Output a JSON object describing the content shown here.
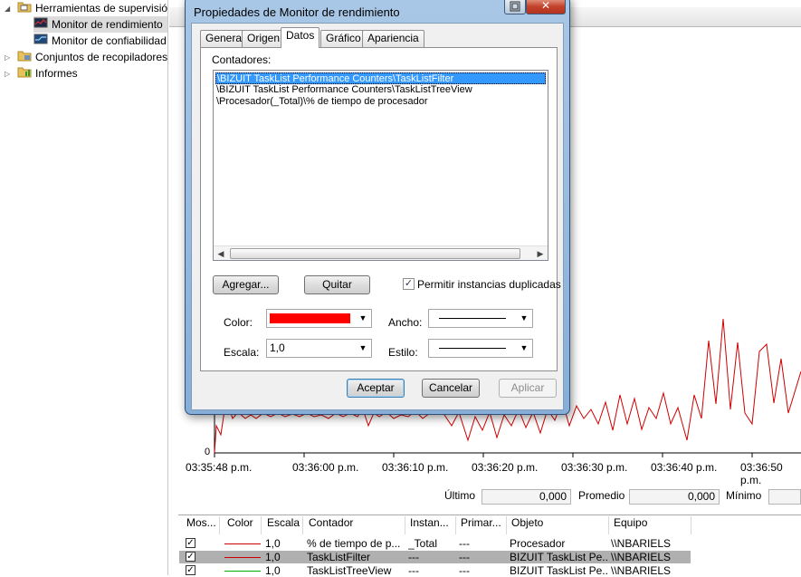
{
  "tree": {
    "items": [
      {
        "label": "Herramientas de supervisión",
        "level": 0,
        "expanded": true
      },
      {
        "label": "Monitor de rendimiento",
        "level": 1,
        "selected": true
      },
      {
        "label": "Monitor de confiabilidad",
        "level": 1
      },
      {
        "label": "Conjuntos de recopiladores de datos",
        "level": 0
      },
      {
        "label": "Informes",
        "level": 0
      }
    ]
  },
  "chart": {
    "y_min_label": "0",
    "x_ticks": [
      "03:35:48 p.m.",
      "03:36:00 p.m.",
      "03:36:10 p.m.",
      "03:36:20 p.m.",
      "03:36:30 p.m.",
      "03:36:40 p.m.",
      "03:36:50 p.m."
    ],
    "stats": {
      "last_label": "Último",
      "last_value": "0,000",
      "avg_label": "Promedio",
      "avg_value": "0,000",
      "min_label": "Mínimo",
      "min_value": ""
    },
    "series_color": "#cc0000"
  },
  "chart_data": {
    "type": "line",
    "x": [
      "03:35:48 p.m.",
      "03:36:00 p.m.",
      "03:36:10 p.m.",
      "03:36:20 p.m.",
      "03:36:30 p.m.",
      "03:36:40 p.m.",
      "03:36:50 p.m."
    ],
    "xlabel": "",
    "ylabel": ""
  },
  "legend": {
    "columns": [
      "Mos...",
      "Color",
      "Escala",
      "Contador",
      "Instan...",
      "Primar...",
      "Objeto",
      "Equipo"
    ],
    "rows": [
      {
        "checked": true,
        "color": "#cc0000",
        "scale": "1,0",
        "counter": "% de tiempo de p...",
        "instance": "_Total",
        "parent": "---",
        "object": "Procesador",
        "computer": "\\\\NBARIELS",
        "highlighted": false
      },
      {
        "checked": true,
        "color": "#cc0000",
        "scale": "1,0",
        "counter": "TaskListFilter",
        "instance": "---",
        "parent": "---",
        "object": "BIZUIT TaskList Pe...",
        "computer": "\\\\NBARIELS",
        "highlighted": true
      },
      {
        "checked": true,
        "color": "#00b000",
        "scale": "1,0",
        "counter": "TaskListTreeView",
        "instance": "---",
        "parent": "---",
        "object": "BIZUIT TaskList Pe...",
        "computer": "\\\\NBARIELS",
        "highlighted": false
      }
    ]
  },
  "dialog": {
    "title": "Propiedades de Monitor de rendimiento",
    "help_icon": "help-icon",
    "close_glyph": "✕",
    "tabs": [
      "General",
      "Origen",
      "Datos",
      "Gráfico",
      "Apariencia"
    ],
    "active_tab": "Datos",
    "counters_label": "Contadores:",
    "counters": [
      "\\BIZUIT TaskList Performance Counters\\TaskListFilter",
      "\\BIZUIT TaskList Performance Counters\\TaskListTreeView",
      "\\Procesador(_Total)\\% de tiempo de procesador"
    ],
    "add_button": "Agregar...",
    "remove_button": "Quitar",
    "allow_duplicates_label": "Permitir instancias duplicadas",
    "allow_duplicates_checked": true,
    "color_label": "Color:",
    "color_value": "#ff0000",
    "width_label": "Ancho:",
    "scale_label": "Escala:",
    "scale_value": "1,0",
    "style_label": "Estilo:",
    "ok_button": "Aceptar",
    "cancel_button": "Cancelar",
    "apply_button": "Aplicar"
  }
}
